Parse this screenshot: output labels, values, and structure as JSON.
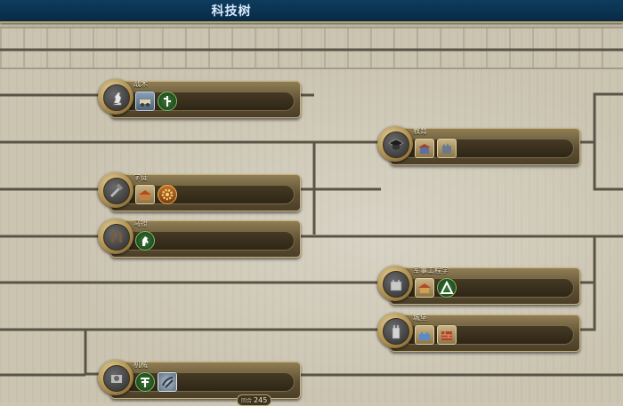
{
  "window": {
    "title": "科技树"
  },
  "techs": [
    {
      "id": "tactics",
      "name": "战术",
      "icon": "knight-chess-icon",
      "unlocks": [
        {
          "icon": "wagon-unit-icon",
          "style": "u-unit"
        },
        {
          "icon": "green-ability-icon",
          "style": "u-green"
        }
      ]
    },
    {
      "id": "education",
      "name": "教育",
      "icon": "mortarboard-icon",
      "unlocks": [
        {
          "icon": "university-building-icon",
          "style": "u-bld"
        },
        {
          "icon": "wonder-building-icon",
          "style": "u-bld"
        }
      ]
    },
    {
      "id": "apprentice",
      "name": "学徒",
      "icon": "hammer-anvil-icon",
      "unlocks": [
        {
          "icon": "workshop-building-icon",
          "style": "u-bld"
        },
        {
          "icon": "gear-icon",
          "style": "u-gear"
        }
      ]
    },
    {
      "id": "stirrups",
      "name": "马镫",
      "icon": "horseshoe-icon",
      "unlocks": [
        {
          "icon": "horse-ability-icon",
          "style": "u-green"
        }
      ]
    },
    {
      "id": "military-engineering",
      "name": "军事工程学",
      "icon": "fortress-tower-icon",
      "unlocks": [
        {
          "icon": "military-building-icon",
          "style": "u-bld"
        },
        {
          "icon": "upgrade-ability-icon",
          "style": "u-green"
        }
      ]
    },
    {
      "id": "castles",
      "name": "城堡",
      "icon": "castle-tower-icon",
      "unlocks": [
        {
          "icon": "castle-building-icon",
          "style": "u-bld"
        },
        {
          "icon": "wall-building-icon",
          "style": "u-bld"
        }
      ]
    },
    {
      "id": "machinery",
      "name": "机械",
      "icon": "machinery-icon",
      "unlocks": [
        {
          "icon": "lumbermill-ability-icon",
          "style": "u-green"
        },
        {
          "icon": "crossbow-unit-icon",
          "style": "u-steel"
        }
      ]
    }
  ],
  "turns": {
    "prefix": "回合",
    "value": "245"
  }
}
